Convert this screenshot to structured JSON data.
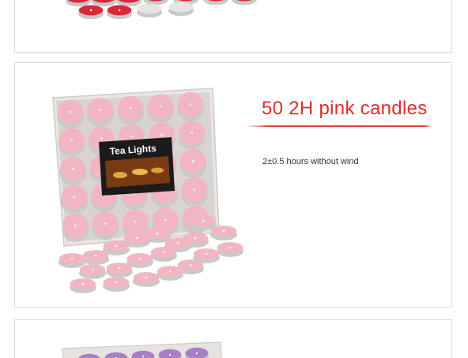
{
  "product": {
    "title": "50 2H pink candles",
    "subtitle": "2±0.5 hours without wind",
    "box_label": "Tea Lights"
  },
  "colors": {
    "title_red": "#d9302c",
    "candle_pink": "#f2b6c3",
    "candle_red": "#d8283a",
    "candle_purple": "#a77fc4",
    "tin_silver": "#c9c9c9"
  }
}
